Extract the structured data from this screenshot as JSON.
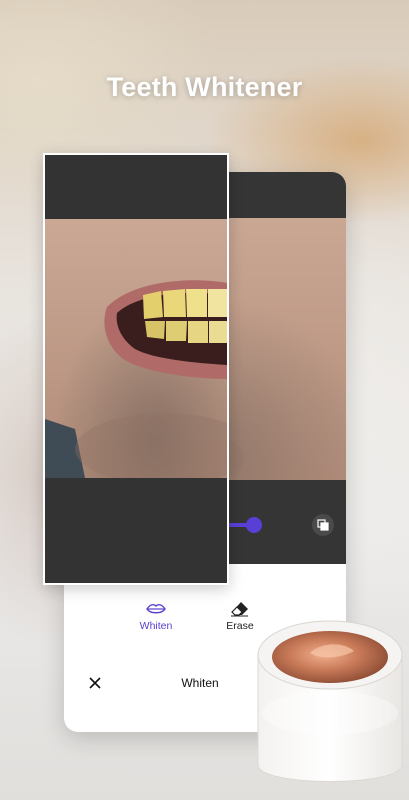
{
  "headline": "Teeth Whitener",
  "tools": [
    {
      "label": "Whiten",
      "icon": "lips-icon",
      "active": true
    },
    {
      "label": "Erase",
      "icon": "eraser-icon",
      "active": false
    }
  ],
  "bottom_bar": {
    "title": "Whiten",
    "close_icon": "close-icon"
  },
  "slider": {
    "value": 1.0
  },
  "colors": {
    "accent": "#5b3fd0",
    "panel_dark": "#353535",
    "headline": "#ffffff"
  }
}
